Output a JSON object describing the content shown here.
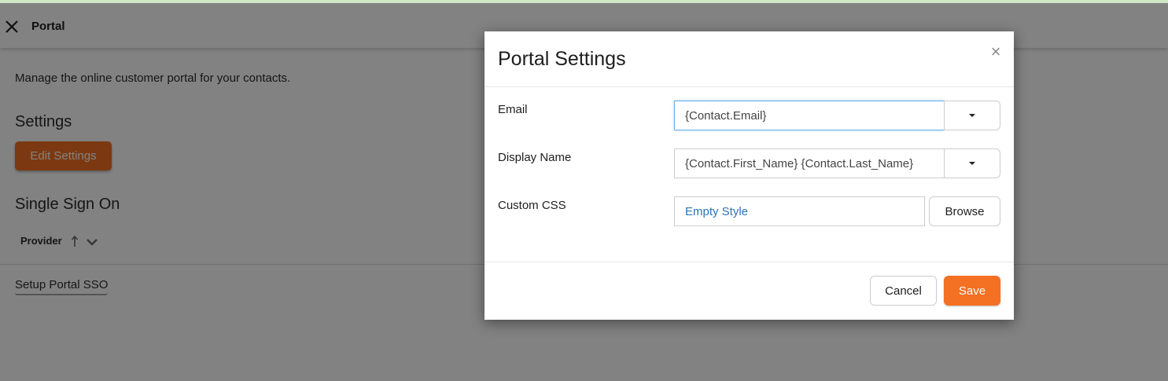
{
  "page": {
    "title": "Portal",
    "description": "Manage the online customer portal for your contacts.",
    "settings_heading": "Settings",
    "edit_settings_label": "Edit Settings",
    "sso_heading": "Single Sign On",
    "table": {
      "columns": [
        {
          "label": "Provider",
          "sort": "ascending"
        }
      ]
    },
    "setup_sso_label": "Setup Portal SSO",
    "close_icon": "close-icon"
  },
  "modal": {
    "title": "Portal Settings",
    "close_glyph": "×",
    "fields": {
      "email": {
        "label": "Email",
        "value": "{Contact.Email}"
      },
      "display_name": {
        "label": "Display Name",
        "value": "{Contact.First_Name} {Contact.Last_Name}"
      },
      "custom_css": {
        "label": "Custom CSS",
        "value": "Empty Style",
        "browse_label": "Browse"
      }
    },
    "cancel_label": "Cancel",
    "save_label": "Save"
  },
  "colors": {
    "accent": "#f47023",
    "focus_border": "#66afe9",
    "link_text": "#2f74b7",
    "overlay": "rgba(0,0,0,0.49)"
  }
}
